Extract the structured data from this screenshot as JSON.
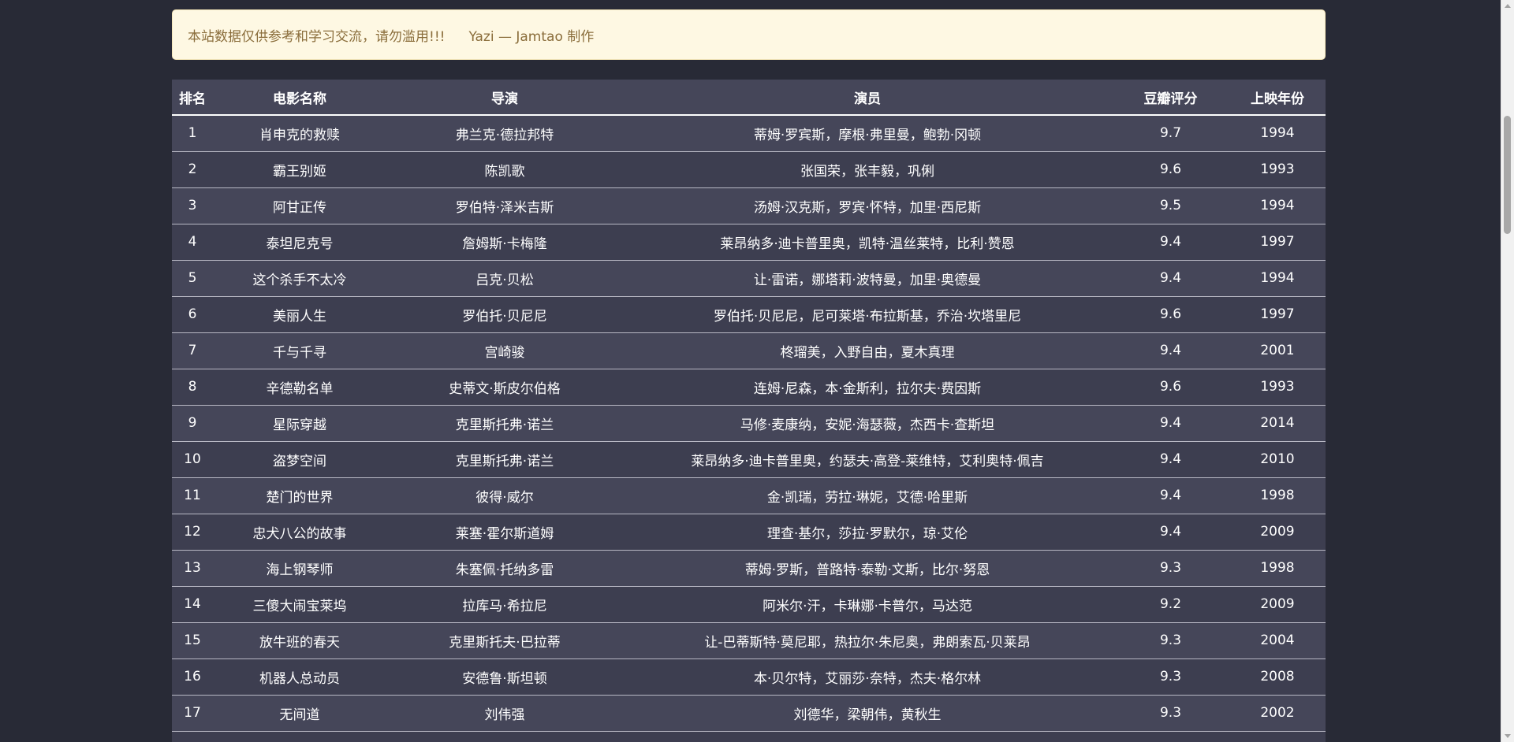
{
  "notice": {
    "text": "本站数据仅供参考和学习交流，请勿滥用!!!",
    "author": "Yazi — Jamtao 制作"
  },
  "table": {
    "headers": [
      "排名",
      "电影名称",
      "导演",
      "演员",
      "豆瓣评分",
      "上映年份"
    ],
    "rows": [
      [
        "1",
        "肖申克的救赎",
        "弗兰克·德拉邦特",
        "蒂姆·罗宾斯，摩根·弗里曼，鲍勃·冈顿",
        "9.7",
        "1994"
      ],
      [
        "2",
        "霸王别姬",
        "陈凯歌",
        "张国荣，张丰毅，巩俐",
        "9.6",
        "1993"
      ],
      [
        "3",
        "阿甘正传",
        "罗伯特·泽米吉斯",
        "汤姆·汉克斯，罗宾·怀特，加里·西尼斯",
        "9.5",
        "1994"
      ],
      [
        "4",
        "泰坦尼克号",
        "詹姆斯·卡梅隆",
        "莱昂纳多·迪卡普里奥，凯特·温丝莱特，比利·赞恩",
        "9.4",
        "1997"
      ],
      [
        "5",
        "这个杀手不太冷",
        "吕克·贝松",
        "让·雷诺，娜塔莉·波特曼，加里·奥德曼",
        "9.4",
        "1994"
      ],
      [
        "6",
        "美丽人生",
        "罗伯托·贝尼尼",
        "罗伯托·贝尼尼，尼可莱塔·布拉斯基，乔治·坎塔里尼",
        "9.6",
        "1997"
      ],
      [
        "7",
        "千与千寻",
        "宫崎骏",
        "柊瑠美，入野自由，夏木真理",
        "9.4",
        "2001"
      ],
      [
        "8",
        "辛德勒名单",
        "史蒂文·斯皮尔伯格",
        "连姆·尼森，本·金斯利，拉尔夫·费因斯",
        "9.6",
        "1993"
      ],
      [
        "9",
        "星际穿越",
        "克里斯托弗·诺兰",
        "马修·麦康纳，安妮·海瑟薇，杰西卡·查斯坦",
        "9.4",
        "2014"
      ],
      [
        "10",
        "盗梦空间",
        "克里斯托弗·诺兰",
        "莱昂纳多·迪卡普里奥，约瑟夫·高登-莱维特，艾利奥特·佩吉",
        "9.4",
        "2010"
      ],
      [
        "11",
        "楚门的世界",
        "彼得·威尔",
        "金·凯瑞，劳拉·琳妮，艾德·哈里斯",
        "9.4",
        "1998"
      ],
      [
        "12",
        "忠犬八公的故事",
        "莱塞·霍尔斯道姆",
        "理查·基尔，莎拉·罗默尔，琼·艾伦",
        "9.4",
        "2009"
      ],
      [
        "13",
        "海上钢琴师",
        "朱塞佩·托纳多雷",
        "蒂姆·罗斯，普路特·泰勒·文斯，比尔·努恩",
        "9.3",
        "1998"
      ],
      [
        "14",
        "三傻大闹宝莱坞",
        "拉库马·希拉尼",
        "阿米尔·汗，卡琳娜·卡普尔，马达范",
        "9.2",
        "2009"
      ],
      [
        "15",
        "放牛班的春天",
        "克里斯托夫·巴拉蒂",
        "让-巴蒂斯特·莫尼耶，热拉尔·朱尼奥，弗朗索瓦·贝莱昂",
        "9.3",
        "2004"
      ],
      [
        "16",
        "机器人总动员",
        "安德鲁·斯坦顿",
        "本·贝尔特，艾丽莎·奈特，杰夫·格尔林",
        "9.3",
        "2008"
      ],
      [
        "17",
        "无间道",
        "刘伟强",
        "刘德华，梁朝伟，黄秋生",
        "9.3",
        "2002"
      ],
      [
        "",
        "",
        "",
        "",
        "",
        ""
      ]
    ]
  },
  "colors": {
    "background": "#282a36",
    "notice_bg": "#fef8e3",
    "notice_text": "#8a6d3b",
    "table_row": "#454659"
  }
}
